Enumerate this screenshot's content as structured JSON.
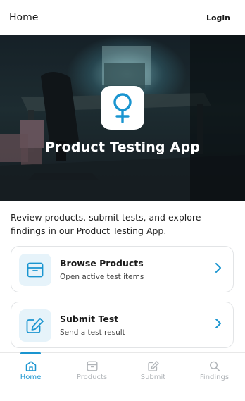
{
  "header": {
    "title": "Home",
    "login_label": "Login"
  },
  "hero": {
    "title": "Product Testing App",
    "icon": "female-symbol-icon"
  },
  "intro": {
    "text": "Review products, submit tests, and explore findings in our Product Testing App."
  },
  "cards": [
    {
      "title": "Browse Products",
      "subtitle": "Open active test items",
      "icon": "box-icon"
    },
    {
      "title": "Submit Test",
      "subtitle": "Send a test result",
      "icon": "edit-icon"
    }
  ],
  "bottom_nav": {
    "active": "Home",
    "items": [
      {
        "label": "Home",
        "icon": "home-icon"
      },
      {
        "label": "Products",
        "icon": "box-icon"
      },
      {
        "label": "Submit",
        "icon": "edit-icon"
      },
      {
        "label": "Findings",
        "icon": "search-icon"
      }
    ]
  },
  "colors": {
    "accent": "#1a95d0",
    "card_icon_bg": "#e6f3fa",
    "inactive_nav": "#b0b4b8"
  }
}
